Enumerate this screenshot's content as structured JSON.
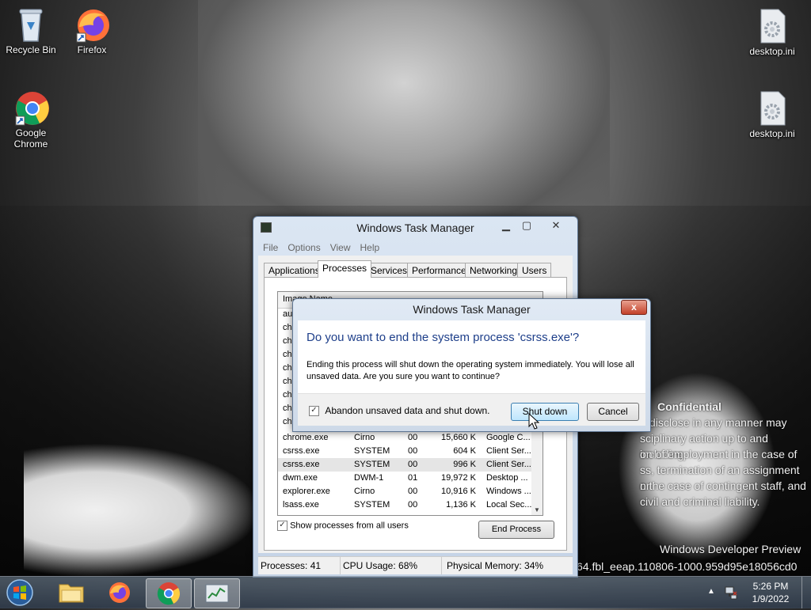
{
  "desktop": {
    "icons": [
      {
        "label": "Recycle Bin"
      },
      {
        "label": "Firefox"
      },
      {
        "label": "Google Chrome"
      },
      {
        "label": "desktop.ini"
      },
      {
        "label": "desktop.ini"
      }
    ],
    "watermark": {
      "heading": "Confidential",
      "lines": [
        "disclose in any manner may",
        "sciplinary action up to and including",
        "on of employment in the case of",
        "ss, termination of an assignment or",
        "n the case of contingent staff, and",
        "civil and criminal liability."
      ],
      "build_title": "Windows Developer Preview",
      "build_string": "64.fbl_eeap.110806-1000.959d95e18056cd0"
    }
  },
  "task_manager": {
    "title": "Windows Task Manager",
    "menu": [
      "File",
      "Options",
      "View",
      "Help"
    ],
    "tabs": [
      "Applications",
      "Processes",
      "Services",
      "Performance",
      "Networking",
      "Users"
    ],
    "active_tab": "Processes",
    "columns": {
      "image_name": "Image Name"
    },
    "hidden_rows": [
      "au",
      "ch",
      "ch",
      "ch",
      "ch",
      "ch",
      "ch",
      "ch",
      "ch"
    ],
    "rows": [
      {
        "name": "chrome.exe",
        "user": "Cirno",
        "cpu": "00",
        "mem": "15,660 K",
        "desc": "Google C..."
      },
      {
        "name": "csrss.exe",
        "user": "SYSTEM",
        "cpu": "00",
        "mem": "604 K",
        "desc": "Client Ser..."
      },
      {
        "name": "csrss.exe",
        "user": "SYSTEM",
        "cpu": "00",
        "mem": "996 K",
        "desc": "Client Ser..."
      },
      {
        "name": "dwm.exe",
        "user": "DWM-1",
        "cpu": "01",
        "mem": "19,972 K",
        "desc": "Desktop ..."
      },
      {
        "name": "explorer.exe",
        "user": "Cirno",
        "cpu": "00",
        "mem": "10,916 K",
        "desc": "Windows ..."
      },
      {
        "name": "lsass.exe",
        "user": "SYSTEM",
        "cpu": "00",
        "mem": "1,136 K",
        "desc": "Local Sec..."
      }
    ],
    "show_all_users_label": "Show processes from all users",
    "show_all_users_checked": true,
    "end_process_label": "End Process",
    "status": {
      "processes": "Processes: 41",
      "cpu": "CPU Usage: 68%",
      "memory": "Physical Memory: 34%"
    }
  },
  "dialog": {
    "title": "Windows Task Manager",
    "close_label": "x",
    "question": "Do you want to end the system process 'csrss.exe'?",
    "message": "Ending this process will shut down the operating system immediately.  You will lose all unsaved data.  Are you sure you want to continue?",
    "checkbox_label": "Abandon unsaved data and shut down.",
    "checkbox_checked": true,
    "shutdown_label": "Shut down",
    "cancel_label": "Cancel"
  },
  "taskbar": {
    "time": "5:26 PM",
    "date": "1/9/2022"
  },
  "colors": {
    "accent": "#3b6ea5",
    "close_red": "#c3412a"
  }
}
